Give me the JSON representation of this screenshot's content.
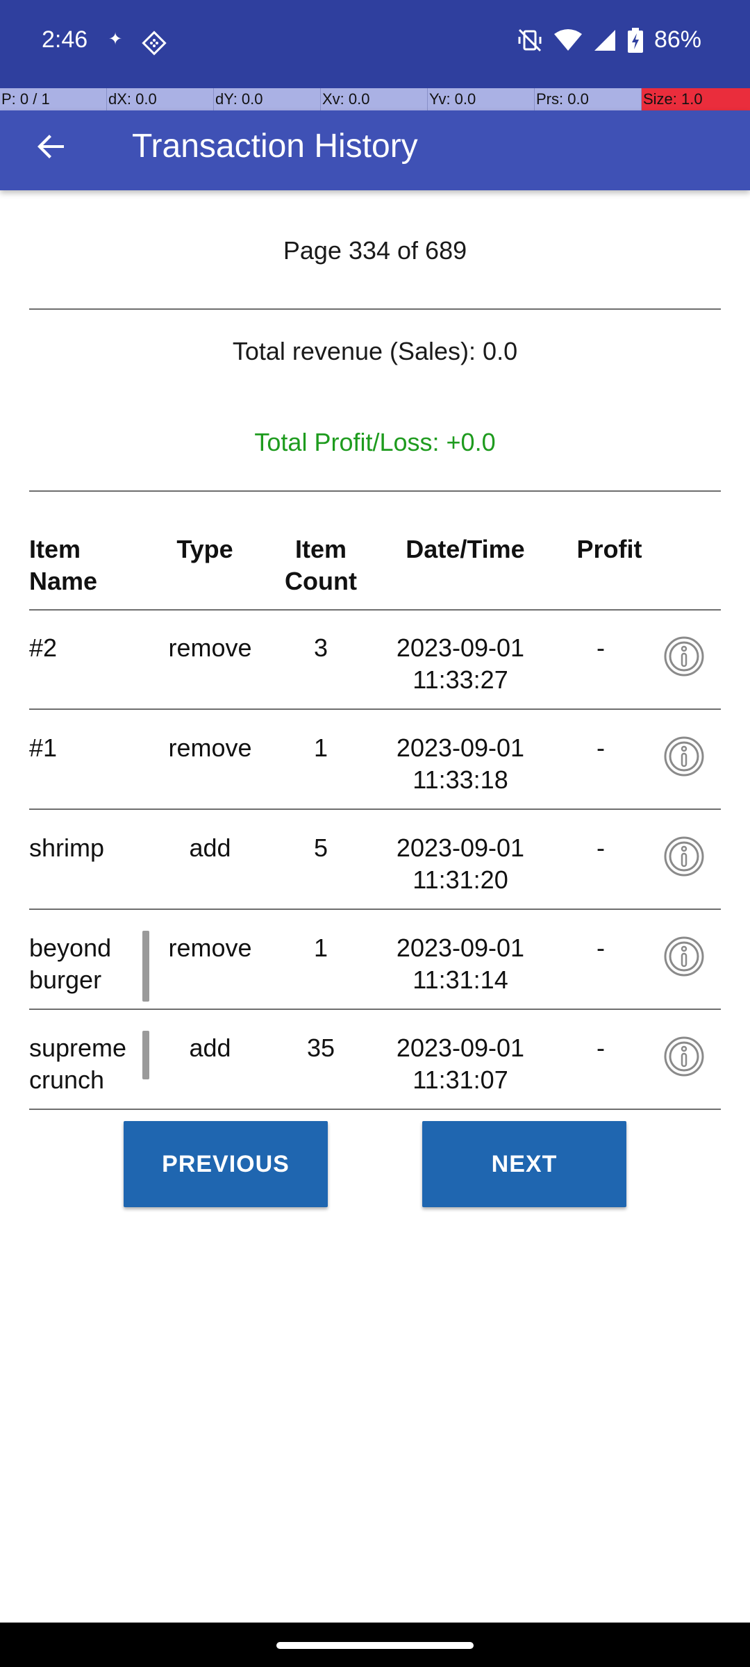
{
  "status_bar": {
    "time": "2:46",
    "battery": "86%",
    "icons": [
      "sparkle-icon",
      "app-icon",
      "vibrate-off-icon",
      "wifi-icon",
      "signal-icon",
      "battery-icon"
    ]
  },
  "debug_bar": {
    "pointer": "P: 0 / 1",
    "dx": "dX: 0.0",
    "dy": "dY: 0.0",
    "xv": "Xv: 0.0",
    "yv": "Yv: 0.0",
    "prs": "Prs: 0.0",
    "size": "Size: 1.0"
  },
  "app_bar": {
    "title": "Transaction History",
    "back_icon": "arrow-back-icon"
  },
  "summary": {
    "page": "Page 334 of 689",
    "revenue": "Total revenue (Sales): 0.0",
    "profit_loss": "Total Profit/Loss: +0.0",
    "profit_color": "#1e9b1e"
  },
  "table": {
    "headers": {
      "item_name_1": "Item",
      "item_name_2": "Name",
      "type": "Type",
      "count_1": "Item",
      "count_2": "Count",
      "datetime": "Date/Time",
      "profit": "Profit"
    },
    "rows": [
      {
        "name_1": "#2",
        "name_2": "",
        "type": "remove",
        "count": "3",
        "date": "2023-09-01",
        "time": "11:33:27",
        "profit": "-"
      },
      {
        "name_1": "#1",
        "name_2": "",
        "type": "remove",
        "count": "1",
        "date": "2023-09-01",
        "time": "11:33:18",
        "profit": "-"
      },
      {
        "name_1": "shrimp",
        "name_2": "",
        "type": "add",
        "count": "5",
        "date": "2023-09-01",
        "time": "11:31:20",
        "profit": "-"
      },
      {
        "name_1": "beyond",
        "name_2": "burger",
        "type": "remove",
        "count": "1",
        "date": "2023-09-01",
        "time": "11:31:14",
        "profit": "-"
      },
      {
        "name_1": "supreme",
        "name_2": "crunch",
        "type": "add",
        "count": "35",
        "date": "2023-09-01",
        "time": "11:31:07",
        "profit": "-"
      }
    ]
  },
  "buttons": {
    "previous": "PREVIOUS",
    "next": "NEXT",
    "color": "#1f66b0"
  },
  "colors": {
    "status_bar": "#2f3f9e",
    "app_bar": "#3f51b5"
  }
}
